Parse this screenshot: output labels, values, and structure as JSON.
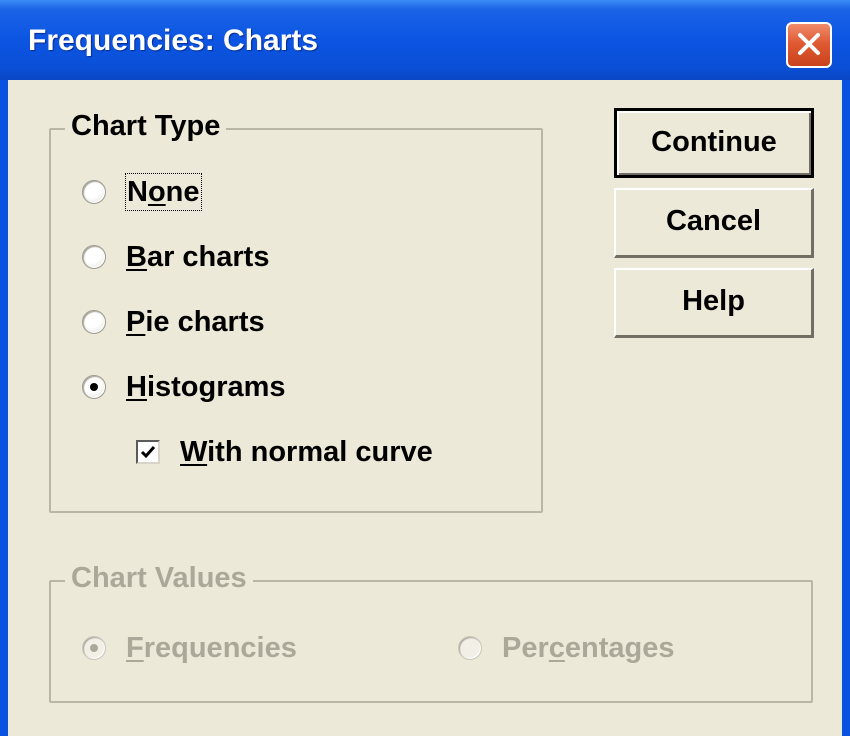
{
  "window": {
    "title": "Frequencies: Charts",
    "close_icon": "close-icon"
  },
  "chart_type": {
    "legend": "Chart Type",
    "options": [
      {
        "pre": "N",
        "key": "o",
        "post": "ne",
        "selected": false
      },
      {
        "pre": "",
        "key": "B",
        "post": "ar charts",
        "selected": false
      },
      {
        "pre": "",
        "key": "P",
        "post": "ie charts",
        "selected": false
      },
      {
        "pre": "",
        "key": "H",
        "post": "istograms",
        "selected": true
      }
    ],
    "normal_curve": {
      "pre": "",
      "key": "W",
      "post": "ith normal curve",
      "checked": true
    }
  },
  "chart_values": {
    "legend": "Chart Values",
    "enabled": false,
    "options": [
      {
        "pre": "",
        "key": "F",
        "post": "requencies",
        "selected": true
      },
      {
        "pre": "Per",
        "key": "c",
        "post": "entages",
        "selected": false
      }
    ]
  },
  "buttons": {
    "continue": "Continue",
    "cancel": "Cancel",
    "help": "Help"
  },
  "colors": {
    "title_bar": "#0a53e0",
    "dialog_face": "#ece9d8",
    "disabled_text": "#aca899",
    "close_button": "#e05a34"
  }
}
